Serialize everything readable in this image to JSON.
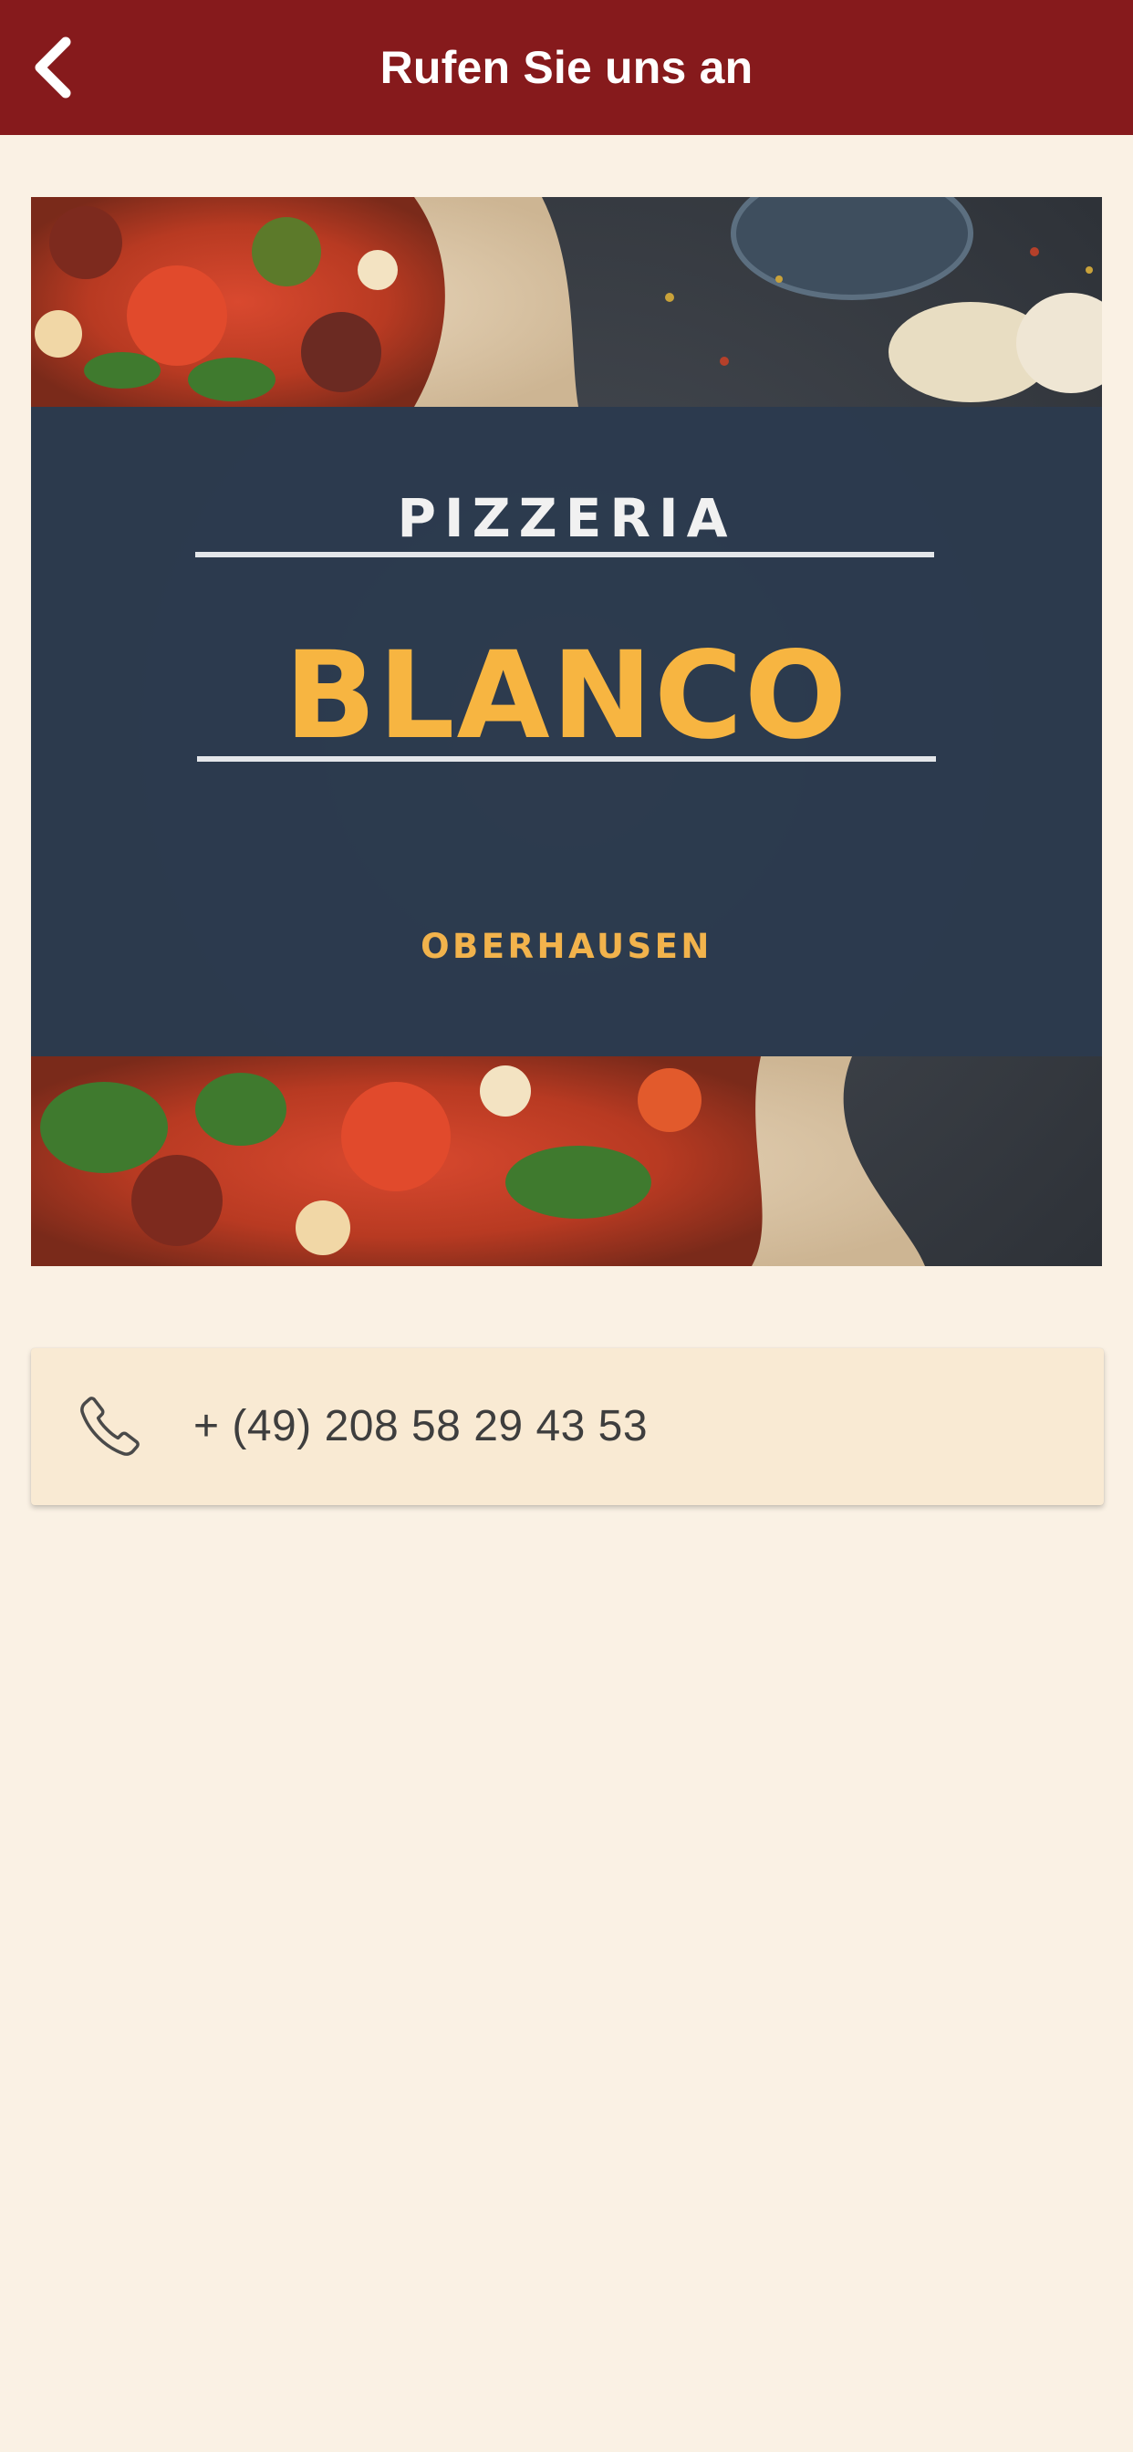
{
  "header": {
    "title": "Rufen Sie uns an",
    "back_icon": "chevron-left-icon"
  },
  "banner": {
    "line1": "PIZZERIA",
    "line2": "BLANCO",
    "line3": "OBERHAUSEN"
  },
  "contact": {
    "phone_icon": "phone-icon",
    "phone_number": "+ (49) 208 58 29 43 53"
  },
  "colors": {
    "header_bg": "#861A1C",
    "page_bg": "#FAF1E4",
    "card_bg": "#F9EAD3",
    "banner_panel": "#2C3A4E",
    "accent_gold": "#F7B541"
  }
}
